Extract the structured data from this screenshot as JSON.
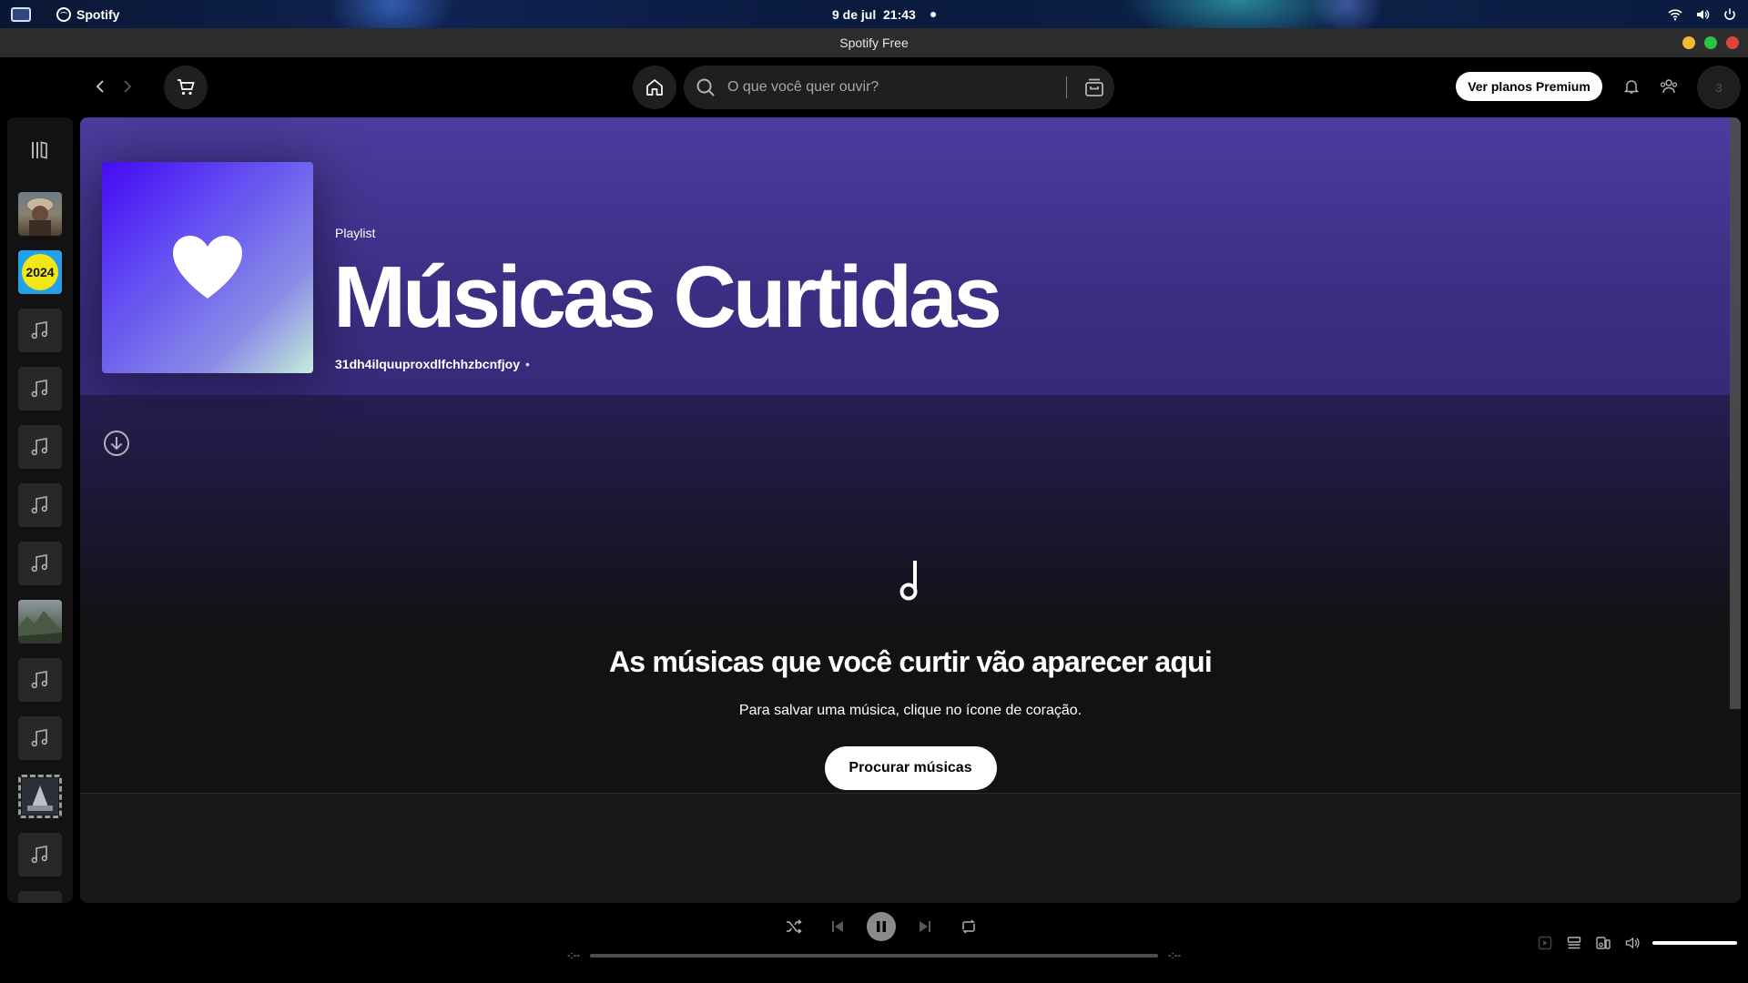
{
  "topbar": {
    "app_name": "Spotify",
    "date": "9 de jul",
    "time": "21:43"
  },
  "window": {
    "title": "Spotify Free"
  },
  "header": {
    "search_placeholder": "O que você quer ouvir?",
    "premium_label": "Ver planos Premium",
    "avatar_initial": "3"
  },
  "sidebar": {
    "items": [
      {
        "kind": "image",
        "icon": "photo-thumbnail"
      },
      {
        "kind": "image",
        "icon": "wrapped-2024-thumbnail",
        "text": "2024"
      },
      {
        "kind": "placeholder",
        "icon": "music-note-icon"
      },
      {
        "kind": "placeholder",
        "icon": "music-note-icon"
      },
      {
        "kind": "placeholder",
        "icon": "music-note-icon"
      },
      {
        "kind": "placeholder",
        "icon": "music-note-icon"
      },
      {
        "kind": "placeholder",
        "icon": "music-note-icon"
      },
      {
        "kind": "image",
        "icon": "landscape-thumbnail"
      },
      {
        "kind": "placeholder",
        "icon": "music-note-icon"
      },
      {
        "kind": "placeholder",
        "icon": "music-note-icon"
      },
      {
        "kind": "image",
        "icon": "framed-photo-thumbnail"
      },
      {
        "kind": "placeholder",
        "icon": "music-note-icon"
      }
    ]
  },
  "playlist": {
    "type_label": "Playlist",
    "title": "Músicas Curtidas",
    "owner": "31dh4ilquuproxdlfchhzbcnfjoy",
    "separator": "•"
  },
  "empty_state": {
    "title": "As músicas que você curtir vão aparecer aqui",
    "subtitle": "Para salvar uma música, clique no ícone de coração.",
    "button": "Procurar músicas"
  },
  "player": {
    "elapsed": "-:--",
    "remaining": "-:--",
    "progress": 0,
    "volume": 1.0
  },
  "colors": {
    "hero_purple": "#4d3c9f",
    "cover_gradient_start": "#450af5",
    "cover_gradient_end": "#c4efd9",
    "close": "#e0443e",
    "maximize": "#29c440",
    "minimize": "#f5b82e"
  }
}
